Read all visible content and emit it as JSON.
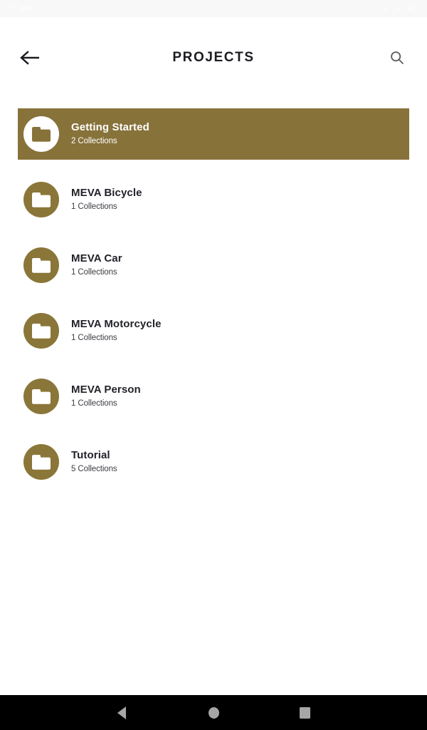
{
  "status_bar": {
    "time": "",
    "left_icons": [
      "signal-icon",
      "app-notification-icon"
    ],
    "right_icons": [
      "wifi-icon",
      "signal-icon",
      "battery-icon"
    ],
    "background": "#f8f8f9"
  },
  "app_bar": {
    "back_label": "back-arrow",
    "title": "PROJECTS",
    "search_label": "search"
  },
  "theme": {
    "accent": "#87723a",
    "badge": "#8a7638",
    "title_color": "#22222a",
    "subtitle_color": "#3d3d44",
    "selected_text": "#ffffff",
    "page_background": "#ffffff",
    "nav_background": "#000000",
    "nav_icon": "#a6a6a6"
  },
  "projects": [
    {
      "title": "Getting Started",
      "subtitle": "2 Collections",
      "selected": true
    },
    {
      "title": "MEVA Bicycle",
      "subtitle": "1 Collections",
      "selected": false
    },
    {
      "title": "MEVA Car",
      "subtitle": "1 Collections",
      "selected": false
    },
    {
      "title": "MEVA Motorcycle",
      "subtitle": "1 Collections",
      "selected": false
    },
    {
      "title": "MEVA Person",
      "subtitle": "1 Collections",
      "selected": false
    },
    {
      "title": "Tutorial",
      "subtitle": "5 Collections",
      "selected": false
    }
  ],
  "nav_bar": {
    "back_label": "back",
    "home_label": "home",
    "recents_label": "recent-apps"
  }
}
